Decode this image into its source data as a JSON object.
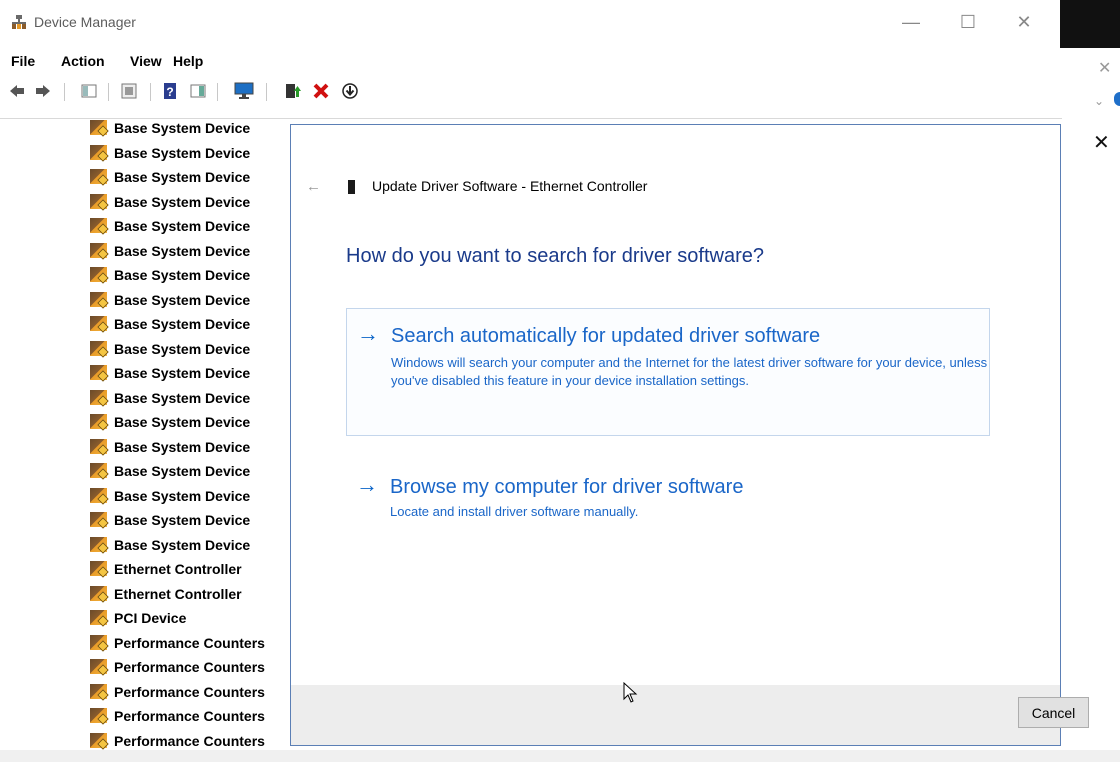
{
  "window": {
    "title": "Device Manager",
    "minimize": "—",
    "maximize": "☐",
    "close": "✕"
  },
  "side_panel": {
    "close": "✕",
    "chevron": "⌄"
  },
  "menu": [
    "File",
    "Action",
    "View",
    "Help"
  ],
  "toolbar_icons": [
    "back-icon",
    "forward-icon",
    "show-hide-console-tree-icon",
    "properties-icon",
    "help-icon",
    "action-pane-icon",
    "monitor-icon",
    "update-driver-icon",
    "uninstall-icon",
    "download-icon"
  ],
  "devices": [
    "Base System Device",
    "Base System Device",
    "Base System Device",
    "Base System Device",
    "Base System Device",
    "Base System Device",
    "Base System Device",
    "Base System Device",
    "Base System Device",
    "Base System Device",
    "Base System Device",
    "Base System Device",
    "Base System Device",
    "Base System Device",
    "Base System Device",
    "Base System Device",
    "Base System Device",
    "Base System Device",
    "Ethernet Controller",
    "Ethernet Controller",
    "PCI Device",
    "Performance Counters",
    "Performance Counters",
    "Performance Counters",
    "Performance Counters",
    "Performance Counters"
  ],
  "dialog": {
    "back": "←",
    "close": "✕",
    "title": "Update Driver Software - Ethernet Controller",
    "question": "How do you want to search for driver software?",
    "options": [
      {
        "arrow": "→",
        "title": "Search automatically for updated driver software",
        "description": "Windows will search your computer and the Internet for the latest driver software for your device, unless you've disabled this feature in your device installation settings."
      },
      {
        "arrow": "→",
        "title": "Browse my computer for driver software",
        "description": "Locate and install driver software manually."
      }
    ],
    "cancel_label": "Cancel"
  },
  "colors": {
    "link_blue": "#1a66c8",
    "heading_blue": "#1a3a8a",
    "dialog_border": "#5b7fb5",
    "footer_gray": "#ededed"
  }
}
